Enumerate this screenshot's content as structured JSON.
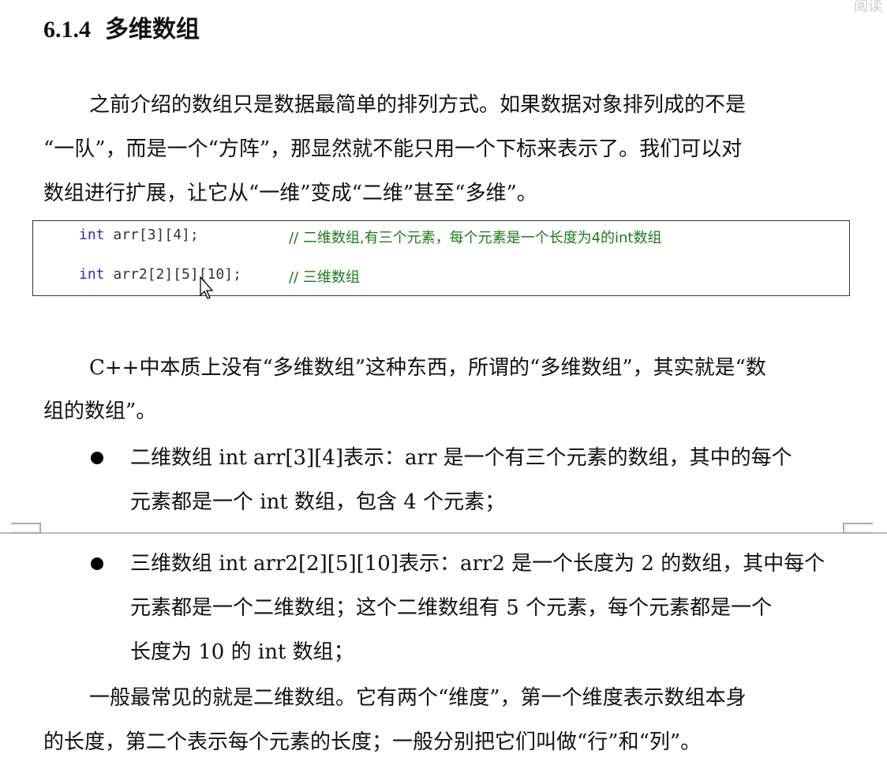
{
  "corner_label": "阅读",
  "heading": {
    "number": "6.1.4",
    "title": "多维数组"
  },
  "para1": [
    "之前介绍的数组只是数据最简单的排列方式。如果数据对象排列成的不是",
    "“一队”，而是一个“方阵”，那显然就不能只用一个下标来表示了。我们可以对",
    "数组进行扩展，让它从“一维”变成“二维”甚至“多维”。"
  ],
  "code": [
    {
      "keyword": "int",
      "decl": " arr[3][4];",
      "comment": "// 二维数组,有三个元素，每个元素是一个长度为4的int数组"
    },
    {
      "keyword": "int",
      "decl": " arr2[2][5][10];",
      "comment": "// 三维数组"
    }
  ],
  "para2": [
    "C++中本质上没有“多维数组”这种东西，所谓的“多维数组”，其实就是“数",
    "组的数组”。"
  ],
  "bullets": [
    {
      "lines": [
        "二维数组 int  arr[3][4]表示：arr 是一个有三个元素的数组，其中的每个",
        "元素都是一个 int 数组，包含 4 个元素；"
      ]
    },
    {
      "lines": [
        "三维数组 int arr2[2][5][10]表示：arr2 是一个长度为 2 的数组，其中每个",
        "元素都是一个二维数组；这个二维数组有 5 个元素，每个元素都是一个",
        "长度为 10 的 int 数组；"
      ]
    }
  ],
  "para3": [
    "一般最常见的就是二维数组。它有两个“维度”，第一个维度表示数组本身",
    "的长度，第二个表示每个元素的长度；一般分别把它们叫做“行”和“列”。"
  ]
}
